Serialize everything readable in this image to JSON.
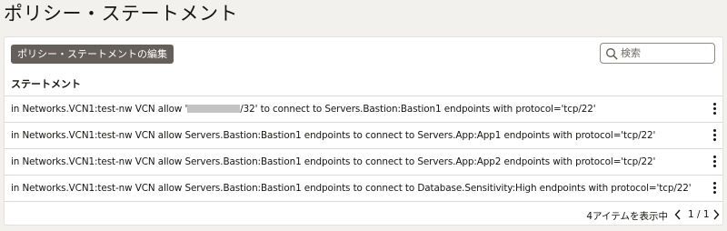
{
  "page": {
    "title": "ポリシー・ステートメント"
  },
  "toolbar": {
    "edit_label": "ポリシー・ステートメントの編集",
    "search_placeholder": "検索"
  },
  "table": {
    "column_header": "ステートメント",
    "rows": [
      {
        "prefix": "in Networks.VCN1:test-nw VCN allow '",
        "redacted": true,
        "suffix": "/32' to connect to Servers.Bastion:Bastion1 endpoints with protocol='tcp/22'"
      },
      {
        "text": "in Networks.VCN1:test-nw VCN allow Servers.Bastion:Bastion1 endpoints to connect to Servers.App:App1 endpoints with protocol='tcp/22'"
      },
      {
        "text": "in Networks.VCN1:test-nw VCN allow Servers.Bastion:Bastion1 endpoints to connect to Servers.App:App2 endpoints with protocol='tcp/22'"
      },
      {
        "text": "in Networks.VCN1:test-nw VCN allow Servers.Bastion:Bastion1 endpoints to connect to Database.Sensitivity:High endpoints with protocol='tcp/22'"
      }
    ],
    "row_action_icon": "kebab-menu-icon"
  },
  "footer": {
    "item_count": "4アイテムを表示中",
    "pagination": "1 / 1"
  },
  "colors": {
    "background": "#f3f1ee",
    "button": "#655f5a",
    "redaction": "#c4c4c4"
  }
}
